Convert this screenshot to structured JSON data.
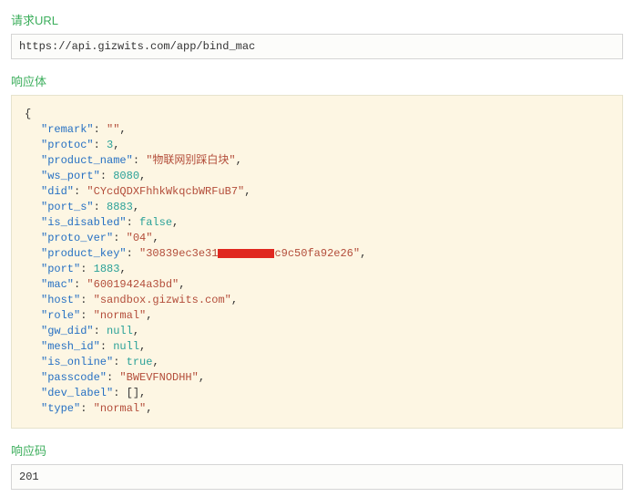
{
  "sections": {
    "request_url_title": "请求URL",
    "response_body_title": "响应体",
    "response_code_title": "响应码"
  },
  "request_url": "https://api.gizwits.com/app/bind_mac",
  "response_code": "201",
  "json_body": {
    "open_brace": "{",
    "remark_key": "\"remark\"",
    "remark_val": "\"\"",
    "protoc_key": "\"protoc\"",
    "protoc_val": "3",
    "product_name_key": "\"product_name\"",
    "product_name_val": "\"物联网别踩白块\"",
    "ws_port_key": "\"ws_port\"",
    "ws_port_val": "8080",
    "did_key": "\"did\"",
    "did_val": "\"CYcdQDXFhhkWkqcbWRFuB7\"",
    "port_s_key": "\"port_s\"",
    "port_s_val": "8883",
    "is_disabled_key": "\"is_disabled\"",
    "is_disabled_val": "false",
    "proto_ver_key": "\"proto_ver\"",
    "proto_ver_val": "\"04\"",
    "product_key_key": "\"product_key\"",
    "product_key_pre": "\"30839ec3e31",
    "product_key_post": "c9c50fa92e26\"",
    "port_key": "\"port\"",
    "port_val": "1883",
    "mac_key": "\"mac\"",
    "mac_val": "\"60019424a3bd\"",
    "host_key": "\"host\"",
    "host_val": "\"sandbox.gizwits.com\"",
    "role_key": "\"role\"",
    "role_val": "\"normal\"",
    "gw_did_key": "\"gw_did\"",
    "gw_did_val": "null",
    "mesh_id_key": "\"mesh_id\"",
    "mesh_id_val": "null",
    "is_online_key": "\"is_online\"",
    "is_online_val": "true",
    "passcode_key": "\"passcode\"",
    "passcode_val": "\"BWEVFNODHH\"",
    "dev_label_key": "\"dev_label\"",
    "dev_label_val": "[]",
    "type_key": "\"type\"",
    "type_val": "\"normal\""
  }
}
